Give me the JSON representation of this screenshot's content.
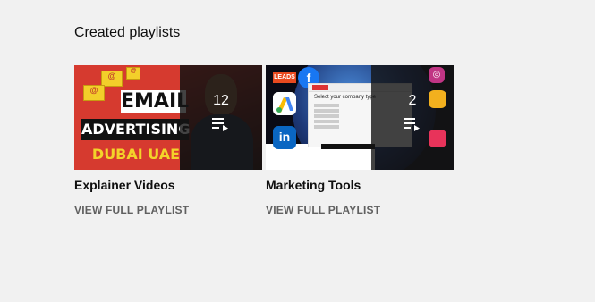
{
  "section": {
    "title": "Created playlists"
  },
  "playlists": [
    {
      "title": "Explainer Videos",
      "count": "12",
      "link_label": "VIEW FULL PLAYLIST",
      "thumbnail": {
        "text_email": "EMAIL",
        "text_advertising": "ADVERTISING",
        "text_location": "DUBAI UAE",
        "colors": {
          "bg": "#d63a2f",
          "accent": "#f3d32a"
        }
      }
    },
    {
      "title": "Marketing Tools",
      "count": "2",
      "link_label": "VIEW FULL PLAYLIST",
      "thumbnail": {
        "text_leads": "LEADS",
        "form_question": "Select your company type",
        "logos": [
          "facebook-logo",
          "google-ads-logo",
          "linkedin-logo",
          "instagram-logo"
        ]
      }
    }
  ],
  "icons": {
    "playlist": "playlist-icon"
  },
  "colors": {
    "page_bg": "#f1f1f1",
    "title": "#0f0f0f",
    "link": "#606060",
    "overlay": "rgba(20,20,20,0.8)"
  }
}
